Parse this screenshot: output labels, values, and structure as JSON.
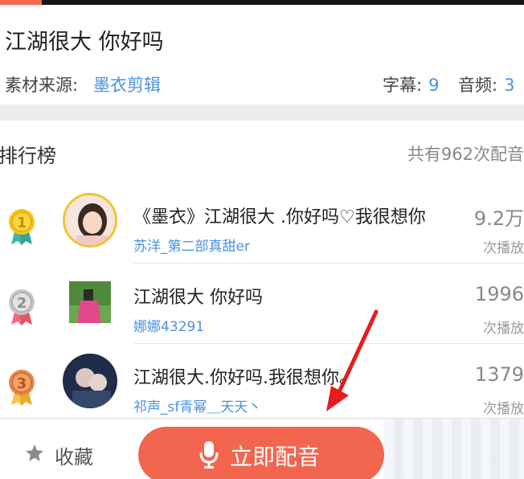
{
  "header": {
    "title": "江湖很大 你好吗",
    "source_label": "素材来源:",
    "source_name": "墨衣剪辑",
    "subtitles_label": "字幕:",
    "subtitles_count": "9",
    "audio_label": "音频:",
    "audio_count": "3"
  },
  "ranking": {
    "title": "排行榜",
    "total": "共有962次配音",
    "items": [
      {
        "rank": "1",
        "title": "《墨衣》江湖很大 .你好吗♡我很想你",
        "user": "苏洋_第二部真甜er",
        "plays": "9.2万",
        "plays_label": "次播放"
      },
      {
        "rank": "2",
        "title": "江湖很大 你好吗",
        "user": "娜娜43291",
        "plays": "1996",
        "plays_label": "次播放"
      },
      {
        "rank": "3",
        "title": "江湖很大.你好吗.我很想你。",
        "user": "祁声_sf青幂＿天天丶",
        "plays": "1379",
        "plays_label": "次播放"
      }
    ]
  },
  "bottom": {
    "favorite_label": "收藏",
    "dub_label": "立即配音"
  },
  "colors": {
    "accent": "#f26650",
    "link": "#4a90e2",
    "gold": "#f5c518",
    "silver": "#b8b8b8",
    "bronze": "#e8884a"
  }
}
